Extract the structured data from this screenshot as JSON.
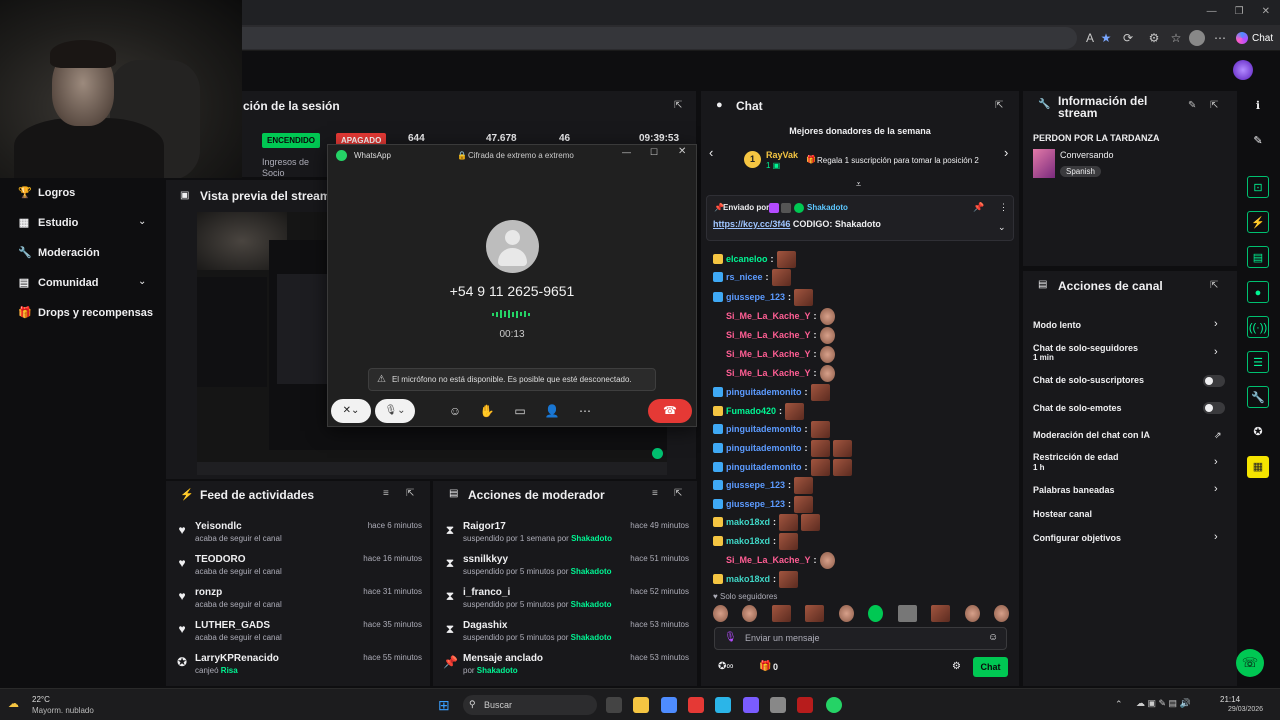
{
  "browser": {
    "chat_button": "Chat",
    "window_controls": [
      "—",
      "❐",
      "✕"
    ]
  },
  "sidebar": {
    "items": [
      {
        "label": "Logros",
        "icon": "trophy-icon"
      },
      {
        "label": "Estudio",
        "icon": "studio-icon",
        "expandable": true
      },
      {
        "label": "Moderación",
        "icon": "wrench-icon"
      },
      {
        "label": "Comunidad",
        "icon": "community-icon",
        "expandable": true
      },
      {
        "label": "Drops y recompensas",
        "icon": "gift-icon"
      }
    ]
  },
  "session": {
    "title": "ción de la sesión",
    "status_on": "ENCENDIDO",
    "status_off": "APAGADO",
    "stats": [
      "644",
      "47.678",
      "46",
      "09:39:53"
    ],
    "label_line1": "Ingresos de",
    "label_line2": "Socio"
  },
  "preview": {
    "title": "Vista previa del stream"
  },
  "whatsapp": {
    "app_name": "WhatsApp",
    "encryption": "Cifrada de extremo a extremo",
    "phone": "+54 9 11 2625-9651",
    "timer": "00:13",
    "warning": "El micrófono no está disponible. Es posible que esté desconectado."
  },
  "activity_feed": {
    "title": "Feed de actividades",
    "items": [
      {
        "name": "Yeisondlc",
        "sub": "acaba de seguir el canal",
        "time": "hace 6 minutos",
        "icon": "heart-icon"
      },
      {
        "name": "TEODORO",
        "sub": "acaba de seguir el canal",
        "time": "hace 16 minutos",
        "icon": "heart-icon"
      },
      {
        "name": "ronzp",
        "sub": "acaba de seguir el canal",
        "time": "hace 31 minutos",
        "icon": "heart-icon"
      },
      {
        "name": "LUTHER_GADS",
        "sub": "acaba de seguir el canal",
        "time": "hace 35 minutos",
        "icon": "heart-icon"
      },
      {
        "name": "LarryKPRenacido",
        "sub_prefix": "canjeó ",
        "sub_reward": "Risa",
        "time": "hace 55 minutos",
        "icon": "points-icon"
      }
    ]
  },
  "mod_actions": {
    "title": "Acciones de moderador",
    "items": [
      {
        "name": "Raigor17",
        "sub_prefix": "suspendido por 1 semana por ",
        "by": "Shakadoto",
        "time": "hace 49 minutos",
        "icon": "hourglass-icon"
      },
      {
        "name": "ssnilkkyy",
        "sub_prefix": "suspendido por 5 minutos por ",
        "by": "Shakadoto",
        "time": "hace 51 minutos",
        "icon": "hourglass-icon"
      },
      {
        "name": "i_franco_i",
        "sub_prefix": "suspendido por 5 minutos por ",
        "by": "Shakadoto",
        "time": "hace 52 minutos",
        "icon": "hourglass-icon"
      },
      {
        "name": "Dagashix",
        "sub_prefix": "suspendido por 5 minutos por ",
        "by": "Shakadoto",
        "time": "hace 53 minutos",
        "icon": "hourglass-icon"
      },
      {
        "name": "Mensaje anclado",
        "sub_prefix": "por ",
        "by": "Shakadoto",
        "time": "hace 53 minutos",
        "icon": "pin-icon"
      }
    ]
  },
  "chat": {
    "title": "Chat",
    "donors_title": "Mejores donadores de la semana",
    "donor_rank": "1",
    "donor_name": "RayVak",
    "donor_count": "1",
    "donor_prompt": "Regala 1 suscripción para tomar la posición 2",
    "pinned_sender_label": "Enviado por",
    "pinned_sender": "Shakadoto",
    "pinned_link": "https://kcy.cc/3f46",
    "pinned_text": " CODIGO: Shakadoto",
    "messages": [
      {
        "user": "elcaneloo",
        "color": "#00f593"
      },
      {
        "user": "rs_nicee",
        "color": "#5c9bff"
      },
      {
        "user": "giussepe_123",
        "color": "#5c9bff"
      },
      {
        "user": "Si_Me_La_Kache_Y",
        "color": "#ff5e94"
      },
      {
        "user": "Si_Me_La_Kache_Y",
        "color": "#ff5e94"
      },
      {
        "user": "Si_Me_La_Kache_Y",
        "color": "#ff5e94"
      },
      {
        "user": "Si_Me_La_Kache_Y",
        "color": "#ff5e94"
      },
      {
        "user": "pinguitademonito",
        "color": "#5c9bff"
      },
      {
        "user": "Fumado420",
        "color": "#00f593"
      },
      {
        "user": "pinguitademonito",
        "color": "#5c9bff"
      },
      {
        "user": "pinguitademonito",
        "color": "#5c9bff"
      },
      {
        "user": "pinguitademonito",
        "color": "#5c9bff"
      },
      {
        "user": "giussepe_123",
        "color": "#5c9bff"
      },
      {
        "user": "giussepe_123",
        "color": "#5c9bff"
      },
      {
        "user": "mako18xd",
        "color": "#3fd6c6"
      },
      {
        "user": "mako18xd",
        "color": "#3fd6c6"
      },
      {
        "user": "Si_Me_La_Kache_Y",
        "color": "#ff5e94"
      },
      {
        "user": "mako18xd",
        "color": "#3fd6c6"
      }
    ],
    "followers_only": "Solo seguidores",
    "input_placeholder": "Enviar un mensaje",
    "points": "0",
    "send_label": "Chat"
  },
  "stream_info": {
    "title_line1": "Información del",
    "title_line2": "stream",
    "stream_title": "PERDON POR LA TARDANZA",
    "category": "Conversando",
    "language": "Spanish"
  },
  "channel_actions": {
    "title": "Acciones de canal",
    "items": [
      {
        "label": "Modo lento",
        "control": "chevron"
      },
      {
        "label": "Chat de solo-seguidores",
        "sub": "1 min",
        "control": "chevron"
      },
      {
        "label": "Chat de solo-suscriptores",
        "control": "toggle"
      },
      {
        "label": "Chat de solo-emotes",
        "control": "toggle"
      },
      {
        "label": "Moderación del chat con IA",
        "control": "external"
      },
      {
        "label": "Restricción de edad",
        "sub": "1 h",
        "control": "chevron"
      },
      {
        "label": "Palabras baneadas",
        "control": "chevron"
      },
      {
        "label": "Hostear canal",
        "control": "none"
      },
      {
        "label": "Configurar objetivos",
        "control": "chevron"
      }
    ]
  },
  "taskbar": {
    "weather_temp": "22°C",
    "weather_desc": "Mayorm. nublado",
    "search_label": "Buscar",
    "time": "21:14",
    "date": "29/03/2026"
  },
  "colors": {
    "accent_green": "#00f593",
    "panel": "#18181b",
    "bg": "#0e0e10",
    "danger": "#e53935"
  }
}
